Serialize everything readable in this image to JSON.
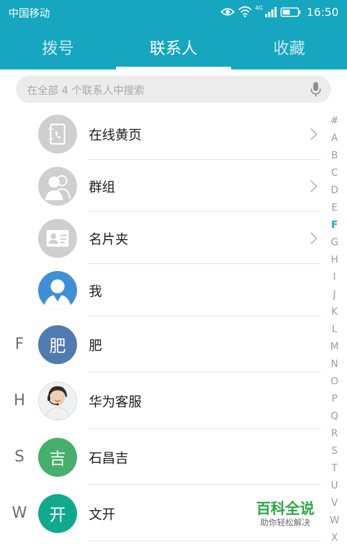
{
  "status_bar": {
    "carrier": "中国移动",
    "network_badge": "4G",
    "time": "16:50",
    "icons": [
      "eye-icon",
      "wifi-icon",
      "signal-icon",
      "battery-icon"
    ]
  },
  "tabs": [
    {
      "label": "拨号",
      "active": false
    },
    {
      "label": "联系人",
      "active": true
    },
    {
      "label": "收藏",
      "active": false
    }
  ],
  "search": {
    "placeholder": "在全部 4 个联系人中搜索",
    "icon": "microphone-icon"
  },
  "groups": [
    {
      "label": "在线黄页",
      "icon": "yellow-pages-icon"
    },
    {
      "label": "群组",
      "icon": "group-icon"
    },
    {
      "label": "名片夹",
      "icon": "business-card-icon"
    },
    {
      "label": "我",
      "icon": "person-icon"
    }
  ],
  "contacts": [
    {
      "letter": "F",
      "name": "肥",
      "avatar_text": "肥",
      "avatar_color": "#4f7bb0"
    },
    {
      "letter": "H",
      "name": "华为客服",
      "avatar_text": "",
      "avatar_icon": "headset-agent-photo"
    },
    {
      "letter": "S",
      "name": "石昌吉",
      "avatar_text": "吉",
      "avatar_color": "#44b06b"
    },
    {
      "letter": "W",
      "name": "文开",
      "avatar_text": "开",
      "avatar_color": "#11a98c"
    }
  ],
  "index": [
    "#",
    "A",
    "B",
    "C",
    "D",
    "E",
    "F",
    "G",
    "H",
    "I",
    "J",
    "K",
    "L",
    "M",
    "N",
    "O",
    "P",
    "Q",
    "R",
    "S",
    "T",
    "U",
    "V",
    "W",
    "X"
  ],
  "index_active": "F",
  "colors": {
    "accent": "#16a6bf"
  },
  "watermark": {
    "title": "百科全说",
    "subtitle": "助你轻松解决"
  }
}
